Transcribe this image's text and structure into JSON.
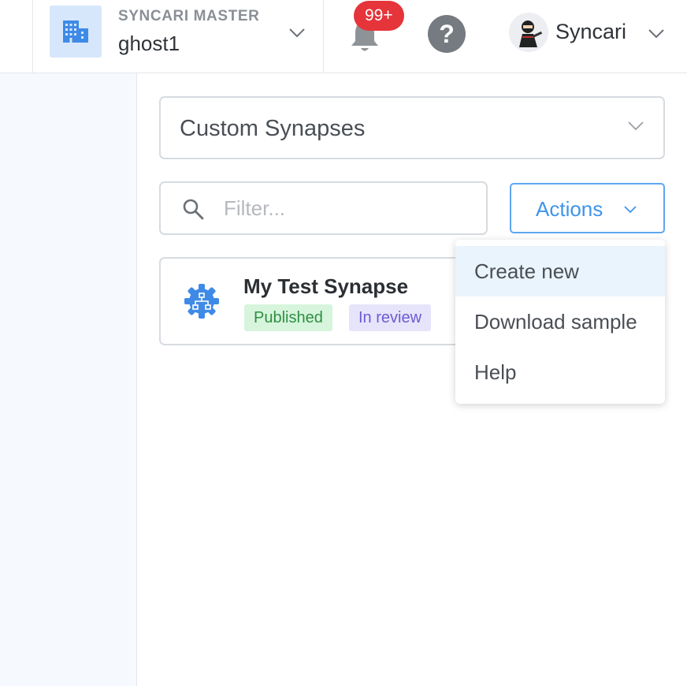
{
  "header": {
    "org_label": "SYNCARI MASTER",
    "org_name": "ghost1",
    "notification_count": "99+",
    "help_symbol": "?",
    "user_name": "Syncari",
    "icons": {
      "org": "building-icon",
      "notifications": "bell-icon",
      "help": "help-icon",
      "avatar": "ninja-avatar",
      "chevron": "chevron-down-icon"
    }
  },
  "main": {
    "select_value": "Custom Synapses",
    "filter_placeholder": "Filter...",
    "actions_label": "Actions",
    "actions_menu": [
      {
        "label": "Create new"
      },
      {
        "label": "Download sample"
      },
      {
        "label": "Help"
      }
    ],
    "cards": [
      {
        "title": "My Test Synapse",
        "icon": "synapse-gear-icon",
        "tags": [
          {
            "label": "Published"
          },
          {
            "label": "In review"
          }
        ]
      }
    ]
  },
  "colors": {
    "accent": "#3f94ea",
    "badge": "#e5343a",
    "sidebar_bg": "#f6f9fd",
    "published_bg": "#d6f5dc",
    "review_bg": "#e6e4fa"
  }
}
